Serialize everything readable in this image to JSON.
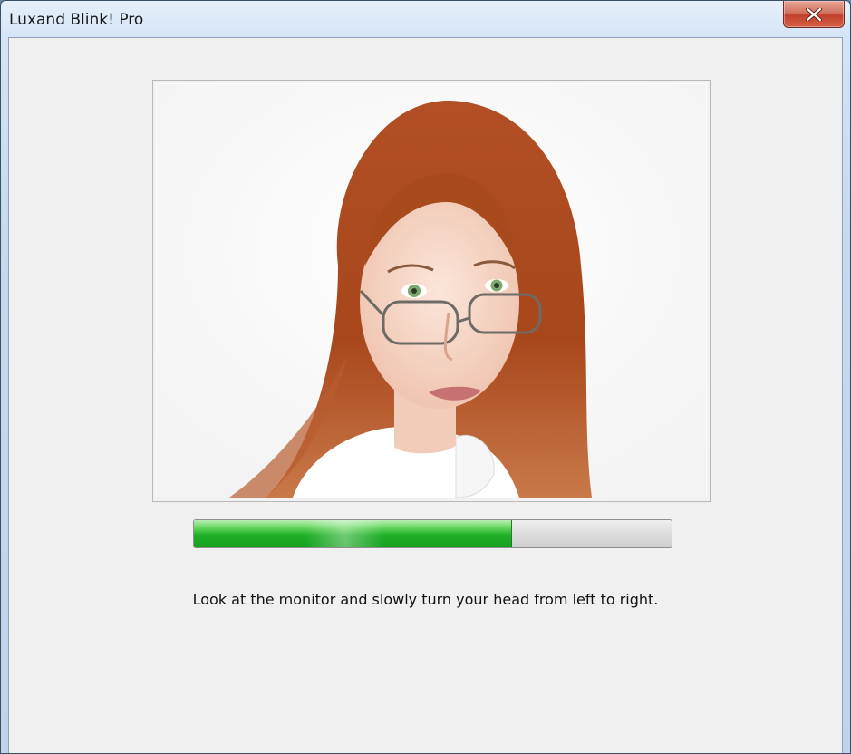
{
  "window": {
    "title": "Luxand Blink! Pro",
    "close_label": "X"
  },
  "camera_view": {
    "subject": "woman-with-red-hair-and-glasses"
  },
  "progress": {
    "value": 0.665,
    "fill_color": "#1fae27"
  },
  "instruction": {
    "text": "Look at the monitor and slowly turn your head from left to right."
  }
}
